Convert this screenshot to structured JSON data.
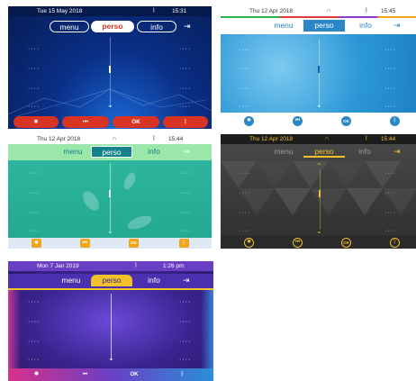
{
  "screens": [
    {
      "date": "Tue 15 May 2018",
      "time": "15:31",
      "tabs": [
        "menu",
        "perso",
        "info"
      ],
      "active_tab": "perso",
      "softkeys": [
        "gear-icon",
        "media-skip-icon",
        "OK",
        "bluetooth-icon"
      ],
      "colors": {
        "bg": "#0a2a73",
        "accent": "#d93323"
      }
    },
    {
      "date": "Thu 12 Apr 2018",
      "time": "15:45",
      "tabs": [
        "menu",
        "perso",
        "info"
      ],
      "active_tab": "perso",
      "softkeys": [
        "gear-icon",
        "media-skip-icon",
        "OK",
        "bluetooth-icon"
      ],
      "colors": {
        "bg": "#2b97d6",
        "accent": "#2a86c4"
      }
    },
    {
      "date": "Thu 12 Apr 2018",
      "time": "15:44",
      "tabs": [
        "menu",
        "perso",
        "info"
      ],
      "active_tab": "perso",
      "softkeys": [
        "gear-icon",
        "media-skip-icon",
        "OK",
        "bluetooth-icon"
      ],
      "colors": {
        "bg": "#27b29a",
        "accent": "#13828a"
      }
    },
    {
      "date": "Thu 12 Apr 2018",
      "time": "15:44",
      "tabs": [
        "menu",
        "perso",
        "info"
      ],
      "active_tab": "perso",
      "softkeys": [
        "gear-icon",
        "media-skip-icon",
        "OK",
        "bluetooth-icon"
      ],
      "colors": {
        "bg": "#3a3a3a",
        "accent": "#e8b21a"
      }
    },
    {
      "date": "Mon 7 Jan 2019",
      "time": "1:26 pm",
      "tabs": [
        "menu",
        "perso",
        "info"
      ],
      "active_tab": "perso",
      "softkeys": [
        "gear-icon",
        "media-skip-icon",
        "OK",
        "bluetooth-icon"
      ],
      "colors": {
        "bg": "#4a2a9a",
        "accent": "#f2c22a"
      }
    }
  ],
  "line_key_placeholder": "····"
}
